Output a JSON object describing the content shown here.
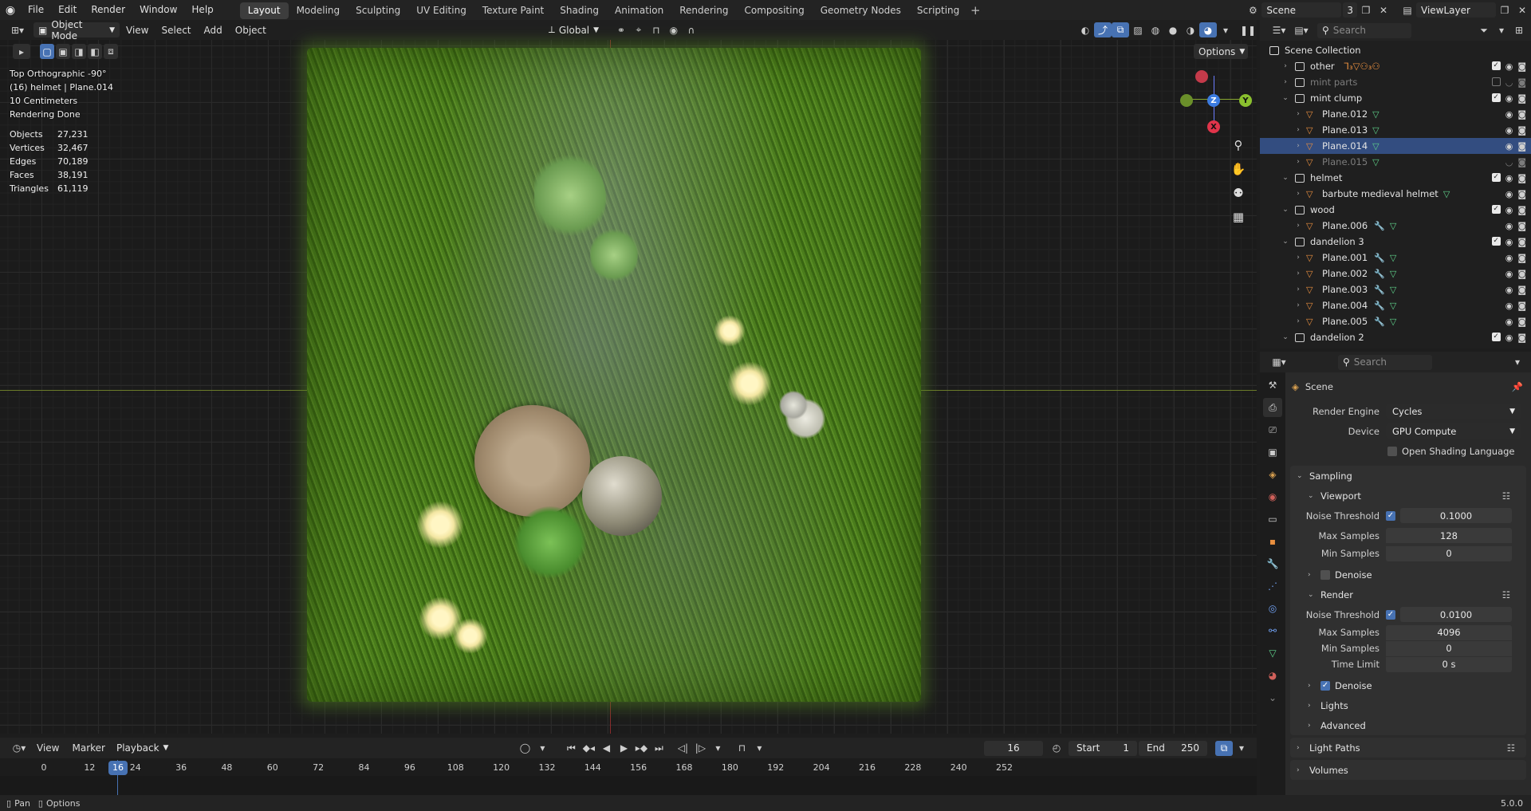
{
  "topbar": {
    "menus": [
      "File",
      "Edit",
      "Render",
      "Window",
      "Help"
    ],
    "workspaces": [
      "Layout",
      "Modeling",
      "Sculpting",
      "UV Editing",
      "Texture Paint",
      "Shading",
      "Animation",
      "Rendering",
      "Compositing",
      "Geometry Nodes",
      "Scripting"
    ],
    "active_workspace": "Layout",
    "scene_name": "Scene",
    "scene_users": "3",
    "view_layer": "ViewLayer"
  },
  "viewport_header": {
    "mode": "Object Mode",
    "menus": [
      "View",
      "Select",
      "Add",
      "Object"
    ],
    "orientation": "Global",
    "options_label": "Options"
  },
  "viewport_overlay": {
    "view_name": "Top Orthographic -90°",
    "object_info": "(16) helmet | Plane.014",
    "scale": "10 Centimeters",
    "status": "Rendering Done",
    "stats": [
      {
        "k": "Objects",
        "v": "27,231"
      },
      {
        "k": "Vertices",
        "v": "32,467"
      },
      {
        "k": "Edges",
        "v": "70,189"
      },
      {
        "k": "Faces",
        "v": "38,191"
      },
      {
        "k": "Triangles",
        "v": "61,119"
      }
    ],
    "gizmo": {
      "x": "X",
      "y": "Y",
      "z": "Z"
    }
  },
  "timeline": {
    "menus": [
      "View",
      "Marker",
      "Playback"
    ],
    "current_frame": "16",
    "start_label": "Start",
    "start": "1",
    "end_label": "End",
    "end": "250",
    "ticks": [
      "0",
      "12",
      "16",
      "24",
      "36",
      "48",
      "60",
      "72",
      "84",
      "96",
      "108",
      "120",
      "132",
      "144",
      "156",
      "168",
      "180",
      "192",
      "204",
      "216",
      "228",
      "240",
      "252"
    ]
  },
  "statusbar": {
    "left1": "Pan",
    "left2": "Options",
    "version": "5.0.0"
  },
  "outliner": {
    "search_placeholder": "Search",
    "root": "Scene Collection",
    "rows": [
      {
        "label": "other",
        "type": "collection",
        "indent": 1,
        "open": false,
        "extra": "⅂₃▽⚇₃⚇"
      },
      {
        "label": "mint parts",
        "type": "collection",
        "indent": 1,
        "open": false,
        "dim": true
      },
      {
        "label": "mint clump",
        "type": "collection",
        "indent": 1,
        "open": true
      },
      {
        "label": "Plane.012",
        "type": "object",
        "indent": 2,
        "mesh": true
      },
      {
        "label": "Plane.013",
        "type": "object",
        "indent": 2,
        "mesh": true
      },
      {
        "label": "Plane.014",
        "type": "object",
        "indent": 2,
        "mesh": true,
        "selected": true
      },
      {
        "label": "Plane.015",
        "type": "object",
        "indent": 2,
        "mesh": true,
        "dim": true
      },
      {
        "label": "helmet",
        "type": "collection",
        "indent": 1,
        "open": true
      },
      {
        "label": "barbute medieval helmet",
        "type": "object",
        "indent": 2,
        "mesh": true
      },
      {
        "label": "wood",
        "type": "collection",
        "indent": 1,
        "open": true
      },
      {
        "label": "Plane.006",
        "type": "object",
        "indent": 2,
        "mod": true,
        "mesh": true
      },
      {
        "label": "dandelion 3",
        "type": "collection",
        "indent": 1,
        "open": true
      },
      {
        "label": "Plane.001",
        "type": "object",
        "indent": 2,
        "mod": true,
        "mesh": true
      },
      {
        "label": "Plane.002",
        "type": "object",
        "indent": 2,
        "mod": true,
        "mesh": true
      },
      {
        "label": "Plane.003",
        "type": "object",
        "indent": 2,
        "mod": true,
        "mesh": true
      },
      {
        "label": "Plane.004",
        "type": "object",
        "indent": 2,
        "mod": true,
        "mesh": true
      },
      {
        "label": "Plane.005",
        "type": "object",
        "indent": 2,
        "mod": true,
        "mesh": true
      },
      {
        "label": "dandelion 2",
        "type": "collection",
        "indent": 1,
        "open": true
      }
    ]
  },
  "properties": {
    "search_placeholder": "Search",
    "context": "Scene",
    "render_engine_label": "Render Engine",
    "render_engine": "Cycles",
    "device_label": "Device",
    "device": "GPU Compute",
    "osl_label": "Open Shading Language",
    "sampling": "Sampling",
    "viewport": "Viewport",
    "render": "Render",
    "noise_threshold_label": "Noise Threshold",
    "max_samples_label": "Max Samples",
    "min_samples_label": "Min Samples",
    "time_limit_label": "Time Limit",
    "vp_noise_threshold": "0.1000",
    "vp_max_samples": "128",
    "vp_min_samples": "0",
    "r_noise_threshold": "0.0100",
    "r_max_samples": "4096",
    "r_min_samples": "0",
    "r_time_limit": "0 s",
    "denoise": "Denoise",
    "lights": "Lights",
    "advanced": "Advanced",
    "light_paths": "Light Paths",
    "volumes": "Volumes"
  }
}
